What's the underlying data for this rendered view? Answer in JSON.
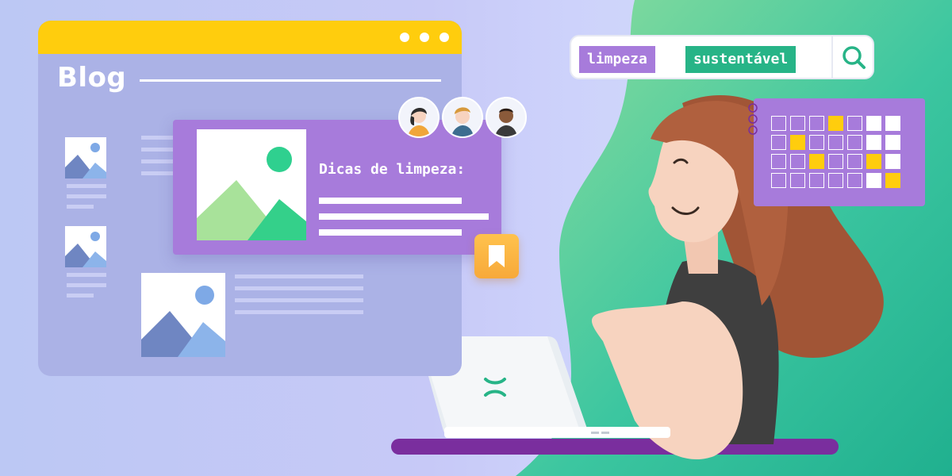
{
  "colors": {
    "accent_purple": "#a77bdb",
    "accent_yellow": "#ffcd0d",
    "accent_green": "#27b487",
    "browser_body": "#abb2e6",
    "bookmark_orange": "#f7a93a",
    "desk_purple": "#7a2e9e"
  },
  "blog": {
    "title": "Blog"
  },
  "featured_card": {
    "heading": "Dicas de limpeza:"
  },
  "search": {
    "tags": [
      "limpeza",
      "sustentável"
    ],
    "icon": "search-icon"
  },
  "bookmark": {
    "icon": "bookmark-icon"
  },
  "laptop": {
    "logo_icon": "x-logo-icon"
  },
  "calendar": {
    "highlighted": [
      {
        "row": 0,
        "col": 3,
        "state": "yellow"
      },
      {
        "row": 1,
        "col": 1,
        "state": "yellow"
      },
      {
        "row": 2,
        "col": 2,
        "state": "yellow"
      },
      {
        "row": 2,
        "col": 5,
        "state": "yellow"
      },
      {
        "row": 3,
        "col": 6,
        "state": "yellow"
      }
    ]
  },
  "avatars": [
    {
      "name": "avatar-woman"
    },
    {
      "name": "avatar-man-blond"
    },
    {
      "name": "avatar-man-dark"
    }
  ]
}
